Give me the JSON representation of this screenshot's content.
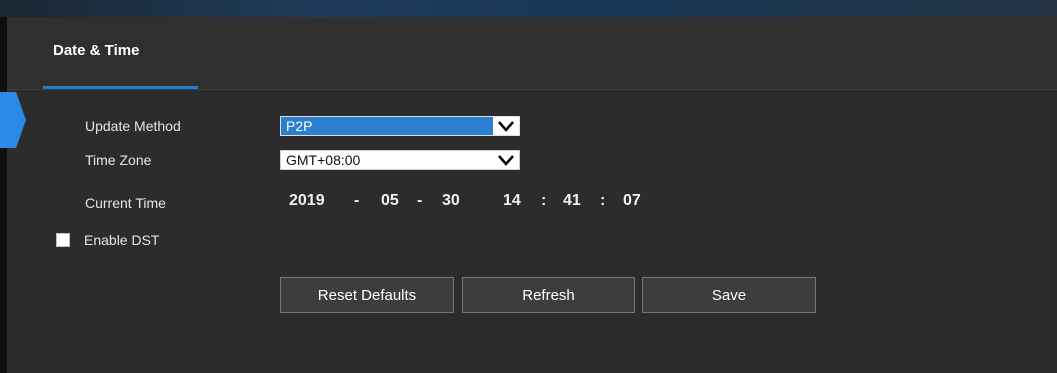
{
  "tab": {
    "title": "Date & Time"
  },
  "form": {
    "update_method": {
      "label": "Update Method",
      "value": "P2P"
    },
    "time_zone": {
      "label": "Time Zone",
      "value": "GMT+08:00"
    },
    "current_time": {
      "label": "Current Time",
      "year": "2019",
      "sep1": "-",
      "month": "05",
      "sep2": "-",
      "day": "30",
      "hour": "14",
      "sep3": ":",
      "minute": "41",
      "sep4": ":",
      "second": "07"
    },
    "dst": {
      "label": "Enable DST",
      "checked": false
    }
  },
  "buttons": {
    "reset": "Reset Defaults",
    "refresh": "Refresh",
    "save": "Save"
  },
  "colors": {
    "accent": "#1d7fd8",
    "panel_bg": "#2c2c2c",
    "select_highlight": "#2b7fd0"
  },
  "icons": {
    "dropdown": "chevron-down-icon",
    "side_marker": "active-section-arrow-icon"
  }
}
